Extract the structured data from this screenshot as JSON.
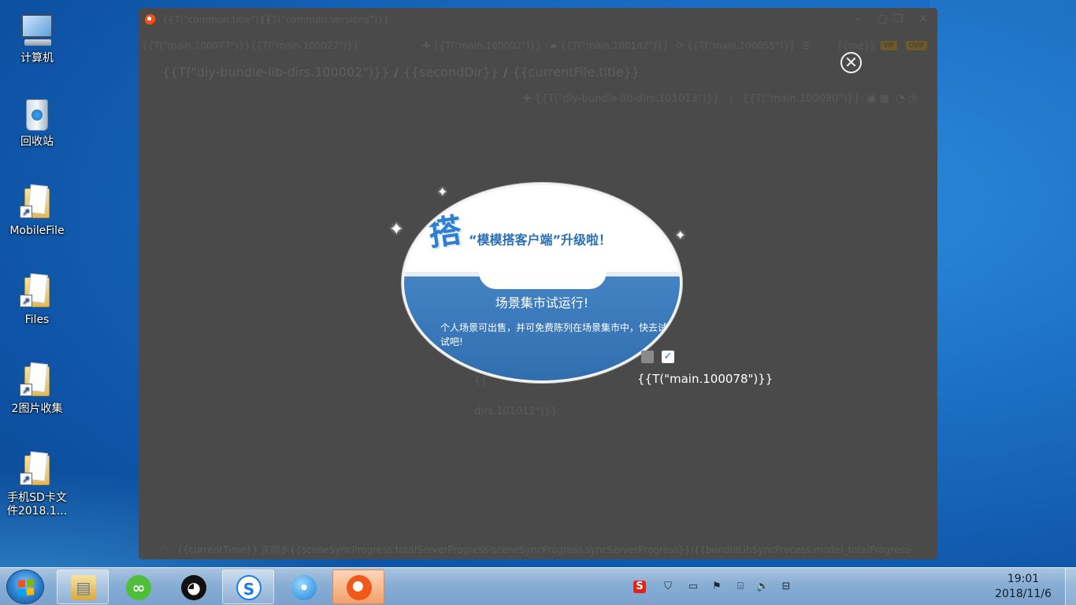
{
  "desktop": {
    "icons": [
      {
        "label": "计算机",
        "icon": "computer-icon"
      },
      {
        "label": "回收站",
        "icon": "recycle-bin-icon"
      },
      {
        "label": "MobileFile",
        "icon": "folder-shortcut-icon"
      },
      {
        "label": "Files",
        "icon": "folder-shortcut-icon"
      },
      {
        "label": "2图片收集",
        "icon": "folder-shortcut-icon"
      },
      {
        "label": "手机SD卡文件2018.1...",
        "icon": "folder-shortcut-icon"
      }
    ]
  },
  "app": {
    "title": "{{T(\"common.title\")}}",
    "version": "{{T(\"common.versions\")}}",
    "toolbar": {
      "left": "{{T(\"main.100077\")}}{{T(\"main.100027\")}}",
      "add": "{{T(\"main.100002\")}}",
      "folder": "{{T(\"main.100142\")}}",
      "sync": "{{T(\"main.100055\")}}",
      "user": "{{me}}",
      "vip_badge": "VIP",
      "dvip_badge": "DVIP"
    },
    "breadcrumb": {
      "root": "{{T(\"diy-bundle-lib-dirs.100002\")}}",
      "second": "{{secondDir}}",
      "current": "{{currentFile.title}}"
    },
    "sub_toolbar": {
      "add": "{{T(\"diy-bundle-lib-dirs.101013\")}}",
      "filter": "{{T(\"main.100090\")}}"
    },
    "empty_hint_1": "{{",
    "empty_hint_2": "dirs.101012\")}}",
    "statusbar": "{{currentTime}} 正同步{{sceneSyncProgress.totalServerProgress-sceneSyncProgress.syncServerProgress}}/{{bundleLibSyncProcess.model_totalProgress-"
  },
  "popup": {
    "logo_char": "搭",
    "title": "“模模搭客户端”升级啦！",
    "subtitle": "场景集市试运行!",
    "body": "个人场景可出售，并可免费陈列在场景集市中，快去试试吧!",
    "checkbox_label": "{{T(\"main.100078\")}}",
    "checkbox_checked": true
  },
  "taskbar": {
    "apps": [
      {
        "name": "file-explorer",
        "active": false
      },
      {
        "name": "wechat",
        "active": false
      },
      {
        "name": "qq",
        "active": false
      },
      {
        "name": "sogou-browser",
        "active": false
      },
      {
        "name": "feiq",
        "active": false
      },
      {
        "name": "momoda-client",
        "active": true
      }
    ],
    "clock_time": "19:01",
    "clock_date": "2018/11/6"
  },
  "colors": {
    "desktop_blue": "#1a6fc4",
    "window_gray": "#4a4a4a",
    "popup_blue": "#3a7ac0",
    "accent_orange": "#ef5a1a"
  }
}
